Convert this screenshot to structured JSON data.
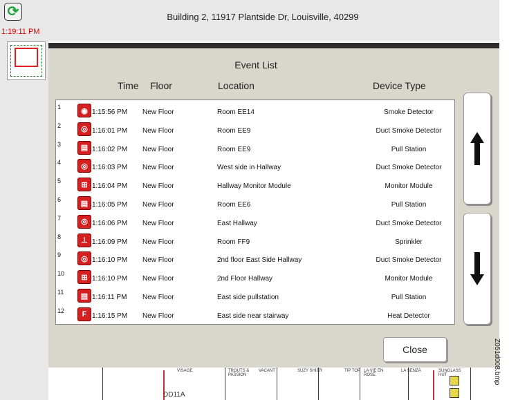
{
  "header": {
    "building": "Building 2, 11917 Plantside Dr, Louisville, 40299",
    "clock": "1:19:11 PM"
  },
  "dialog": {
    "title": "Event List",
    "columns": {
      "time": "Time",
      "floor": "Floor",
      "location": "Location",
      "device": "Device Type"
    },
    "close_label": "Close"
  },
  "events": [
    {
      "num": "1",
      "time": "1:15:56 PM",
      "floor": "New Floor",
      "location": "Room EE14",
      "device": "Smoke Detector",
      "icon": "smoke-detector-icon"
    },
    {
      "num": "2",
      "time": "1:16:01 PM",
      "floor": "New Floor",
      "location": "Room EE9",
      "device": "Duct Smoke Detector",
      "icon": "duct-smoke-detector-icon"
    },
    {
      "num": "3",
      "time": "1:16:02 PM",
      "floor": "New Floor",
      "location": "Room EE9",
      "device": "Pull Station",
      "icon": "pull-station-icon"
    },
    {
      "num": "4",
      "time": "1:16:03 PM",
      "floor": "New Floor",
      "location": "West side in Hallway",
      "device": "Duct Smoke Detector",
      "icon": "duct-smoke-detector-icon"
    },
    {
      "num": "5",
      "time": "1:16:04 PM",
      "floor": "New Floor",
      "location": "Hallway Monitor Module",
      "device": "Monitor Module",
      "icon": "monitor-module-icon"
    },
    {
      "num": "6",
      "time": "1:16:05 PM",
      "floor": "New Floor",
      "location": "Room EE6",
      "device": "Pull Station",
      "icon": "pull-station-icon"
    },
    {
      "num": "7",
      "time": "1:16:06 PM",
      "floor": "New Floor",
      "location": "East Hallway",
      "device": "Duct Smoke Detector",
      "icon": "duct-smoke-detector-icon"
    },
    {
      "num": "8",
      "time": "1:16:09 PM",
      "floor": "New Floor",
      "location": "Room FF9",
      "device": "Sprinkler",
      "icon": "sprinkler-icon"
    },
    {
      "num": "9",
      "time": "1:16:10 PM",
      "floor": "New Floor",
      "location": "2nd floor East Side Hallway",
      "device": "Duct Smoke Detector",
      "icon": "duct-smoke-detector-icon"
    },
    {
      "num": "10",
      "time": "1:16:10 PM",
      "floor": "New Floor",
      "location": "2nd Floor Hallway",
      "device": "Monitor Module",
      "icon": "monitor-module-icon"
    },
    {
      "num": "11",
      "time": "1:16:11 PM",
      "floor": "New Floor",
      "location": "East side pullstation",
      "device": "Pull Station",
      "icon": "pull-station-icon"
    },
    {
      "num": "12",
      "time": "1:16:15 PM",
      "floor": "New Floor",
      "location": "East side near stairway",
      "device": "Heat Detector",
      "icon": "heat-detector-icon"
    }
  ],
  "floorplan": {
    "tag": "DD11A",
    "labels": [
      "VISAGE",
      "TROUTS & PASSION",
      "VACANT",
      "SUZY SHIER",
      "TIP TOP",
      "LA VIE EN ROSE",
      "LA SENZA",
      "SUNGLASS HUT"
    ]
  },
  "watermark": "Z051d008.bmp",
  "colors": {
    "clock": "#e00000",
    "icon_red": "#d42020",
    "dialog_bg": "#d9d6cc",
    "title_bar": "#2b2b2b"
  }
}
